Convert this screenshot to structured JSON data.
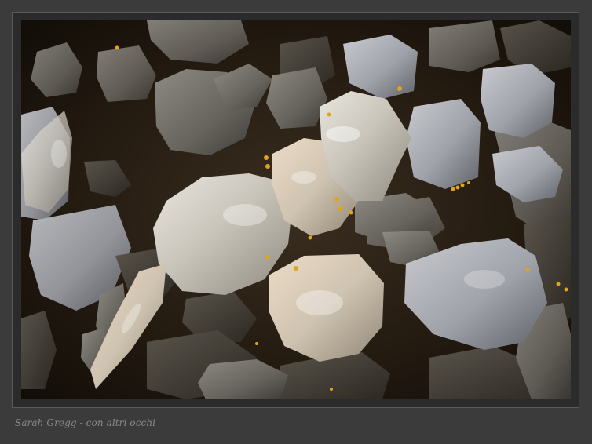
{
  "photo": {
    "subject": "rock-fragments-photo"
  },
  "caption": {
    "text": "Sarah Gregg - con altri occhi"
  },
  "colors": {
    "page_background": "#3b3b3b",
    "frame": "#2b2b2b",
    "caption_text": "#8a8a8a"
  }
}
